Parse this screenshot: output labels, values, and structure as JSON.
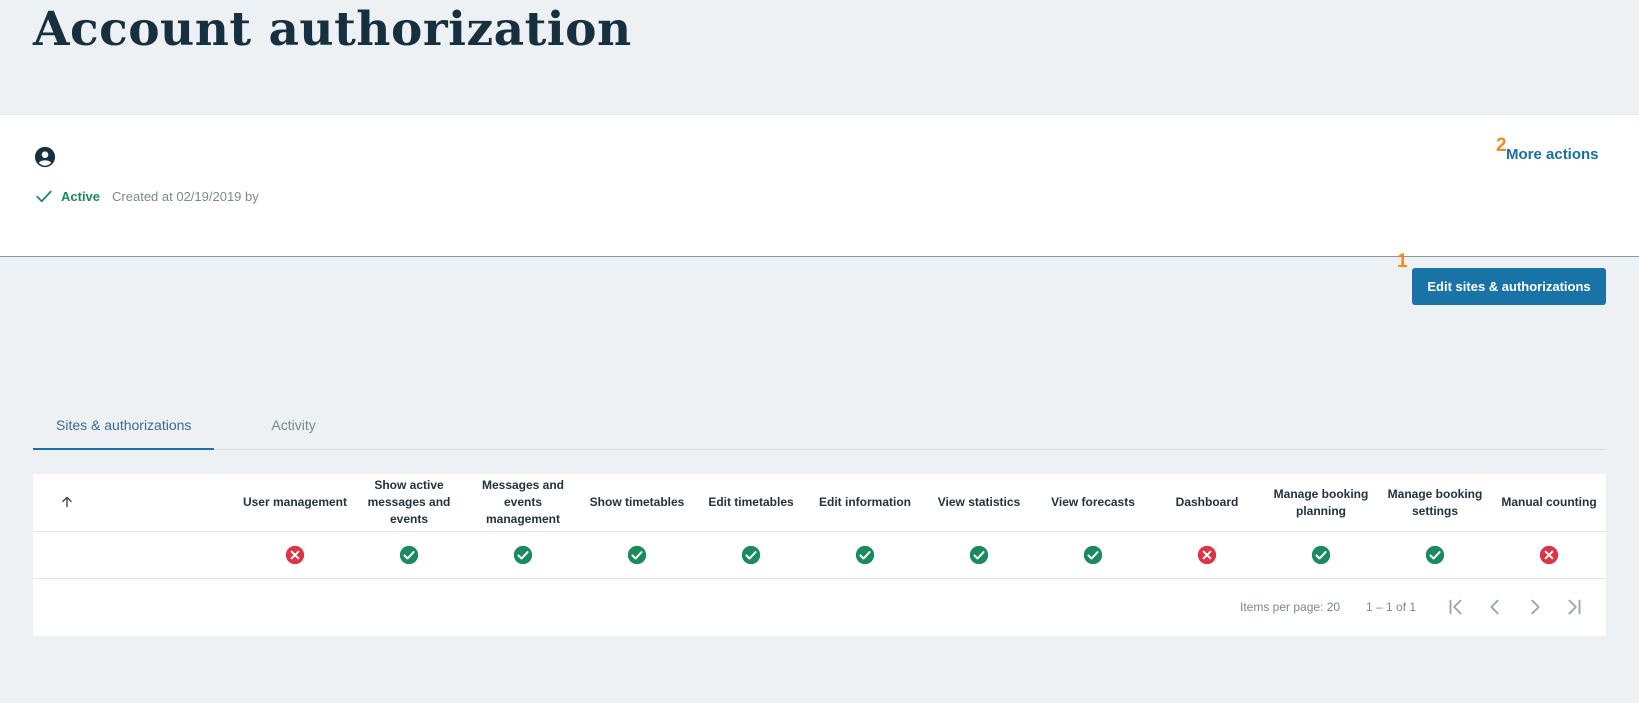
{
  "page": {
    "title": "Account authorization"
  },
  "account": {
    "avatar_icon": "account-circle-icon",
    "status": "Active",
    "status_icon": "check-icon",
    "created": "Created at 02/19/2019 by",
    "more_actions": "More actions",
    "more_actions_marker": "2"
  },
  "edit_button": {
    "label": "Edit sites & authorizations",
    "marker": "1"
  },
  "tabs": [
    {
      "label": "Sites & authorizations",
      "active": true
    },
    {
      "label": "Activity",
      "active": false
    }
  ],
  "table": {
    "sort_icon": "arrow-up-icon",
    "columns": [
      "User management",
      "Show active messages and events",
      "Messages and events management",
      "Show timetables",
      "Edit timetables",
      "Edit information",
      "View statistics",
      "View forecasts",
      "Dashboard",
      "Manage booking planning",
      "Manage booking settings",
      "Manual counting"
    ],
    "rows": [
      {
        "site": "",
        "values": [
          false,
          true,
          true,
          true,
          true,
          true,
          true,
          true,
          false,
          true,
          true,
          false
        ]
      }
    ]
  },
  "pagination": {
    "items_per_page": "Items per page: 20",
    "range": "1 – 1 of 1",
    "icons": [
      "first-page-icon",
      "previous-page-icon",
      "next-page-icon",
      "last-page-icon"
    ]
  },
  "colors": {
    "accent": "#1a73a6",
    "granted": "#1b8a5e",
    "denied": "#dc3545",
    "marker": "#f08a24",
    "background": "#edf1f4"
  }
}
